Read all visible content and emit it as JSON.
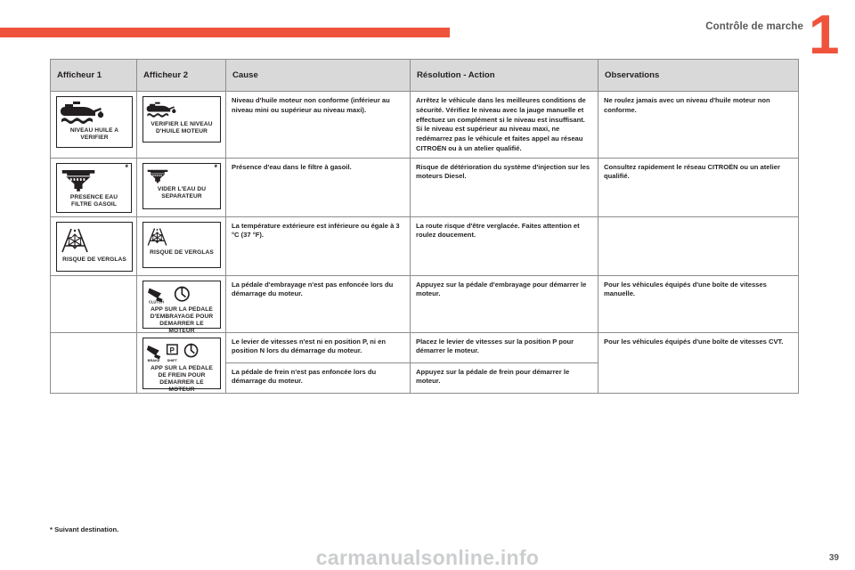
{
  "header": {
    "title": "Contrôle de marche",
    "chapter_number": "1"
  },
  "table": {
    "columns": [
      "Afficheur 1",
      "Afficheur 2",
      "Cause",
      "Résolution - Action",
      "Observations"
    ],
    "rows": [
      {
        "display1": {
          "icon": "oil-can-level-icon",
          "caption": "NIVEAU HUILE A VERIFIER",
          "asterisk": ""
        },
        "display2": {
          "icon": "oil-can-level-icon",
          "caption": "VERIFIER LE NIVEAU\nD'HUILE MOTEUR",
          "asterisk": ""
        },
        "cause": "Niveau d'huile moteur non conforme (inférieur au niveau mini ou supérieur au niveau maxi).",
        "action": "Arrêtez le véhicule dans les meilleures conditions de sécurité. Vérifiez le niveau avec la jauge manuelle et effectuez un complément si le niveau est insuffisant. Si le niveau est supérieur au niveau maxi, ne redémarrez pas le véhicule et faites appel au réseau CITROËN ou à un atelier qualifié.",
        "observations": "Ne roulez jamais avec un niveau d'huile moteur non conforme."
      },
      {
        "display1": {
          "icon": "fuel-filter-water-icon",
          "caption": "PRESENCE EAU\nFILTRE GASOIL",
          "asterisk": "*"
        },
        "display2": {
          "icon": "fuel-filter-water-icon",
          "caption": "VIDER L'EAU DU\nSEPARATEUR",
          "asterisk": "*"
        },
        "cause": "Présence d'eau dans le filtre à gasoil.",
        "action": "Risque de détérioration du système d'injection sur les moteurs Diesel.",
        "observations": "Consultez rapidement le réseau CITROËN ou un atelier qualifié."
      },
      {
        "display1": {
          "icon": "ice-warning-snowflake-icon",
          "caption": "RISQUE DE VERGLAS",
          "asterisk": ""
        },
        "display2": {
          "icon": "ice-warning-snowflake-icon",
          "caption": "RISQUE DE VERGLAS",
          "asterisk": ""
        },
        "cause": "La température extérieure est inférieure ou égale à 3 °C (37 °F).",
        "action": "La route risque d'être verglacée. Faites attention et roulez doucement.",
        "observations": ""
      },
      {
        "display1": null,
        "display2": {
          "icon": "clutch-pedal-icon",
          "caption": "APP SUR LA PEDALE\nD'EMBRAYAGE POUR\nDEMARRER LE MOTEUR",
          "badge": "CLUTCH",
          "asterisk": ""
        },
        "cause": "La pédale d'embrayage n'est pas enfoncée lors du démarrage du moteur.",
        "action": "Appuyez sur la pédale d'embrayage pour démarrer le moteur.",
        "observations": "Pour les véhicules équipés d'une boîte de vitesses manuelle."
      },
      {
        "display1": null,
        "display2": {
          "icon": "brake-pedal-shift-icon",
          "caption": "APP SUR LA PEDALE\nDE FREIN POUR\nDEMARRER LE MOTEUR",
          "badge_brake": "BRAKE",
          "badge_shift": "SHIFT",
          "badge_park": "P",
          "asterisk": ""
        },
        "cause": "Le levier de vitesses n'est ni en position P, ni en position N lors du démarrage du moteur.",
        "action": "Placez le levier de vitesses sur la position P pour démarrer le moteur.",
        "observations": "Pour les véhicules équipés d'une boîte de vitesses CVT."
      },
      {
        "display1": null,
        "display2": null,
        "cause": "La pédale de frein n'est pas enfoncée lors du démarrage du moteur.",
        "action": "Appuyez sur la pédale de frein pour démarrer le moteur.",
        "observations": ""
      }
    ]
  },
  "footnote": "* Suivant destination.",
  "folio": "39",
  "watermark": "carmanualsonline.info",
  "colors": {
    "accent": "#f0533c",
    "header_fill": "#d9d9d9",
    "border": "#8b8d8f",
    "text": "#231f20"
  }
}
